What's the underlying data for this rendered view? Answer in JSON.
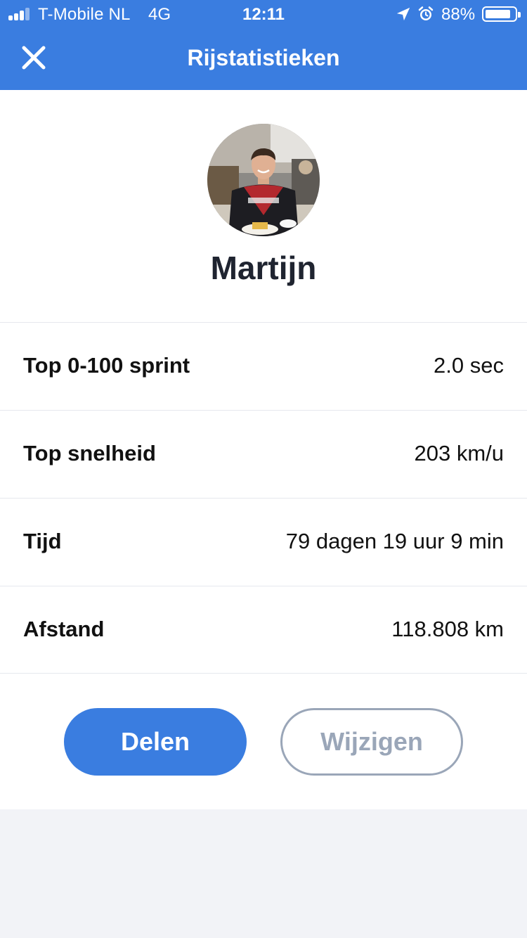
{
  "status_bar": {
    "carrier": "T-Mobile NL",
    "network": "4G",
    "time": "12:11",
    "battery_percent": "88%",
    "battery_level": 0.88,
    "signal_bars": 3,
    "icons": [
      "location-arrow-icon",
      "alarm-clock-icon",
      "battery-icon"
    ]
  },
  "header": {
    "title": "Rijstatistieken",
    "close_icon": "close-icon"
  },
  "profile": {
    "name": "Martijn",
    "avatar_alt": "profile-photo"
  },
  "stats": [
    {
      "label": "Top 0-100 sprint",
      "value": "2.0 sec"
    },
    {
      "label": "Top snelheid",
      "value": "203 km/u"
    },
    {
      "label": "Tijd",
      "value": "79 dagen 19 uur 9 min"
    },
    {
      "label": "Afstand",
      "value": "118.808 km"
    }
  ],
  "actions": {
    "share_label": "Delen",
    "edit_label": "Wijzigen"
  },
  "colors": {
    "accent": "#3a7de0",
    "secondary_button": "#9aa6b8",
    "background": "#f2f3f7"
  }
}
